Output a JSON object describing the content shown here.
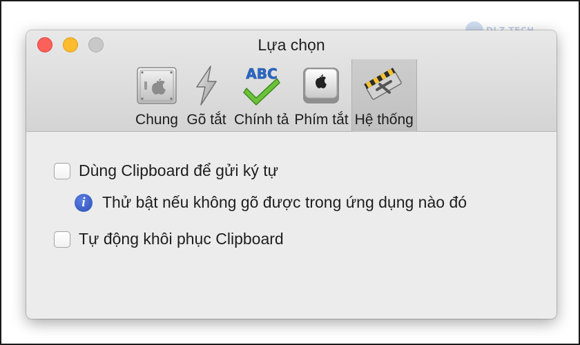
{
  "window": {
    "title": "Lựa chọn"
  },
  "toolbar": {
    "tabs": [
      {
        "label": "Chung",
        "icon": "general-icon",
        "active": false
      },
      {
        "label": "Gõ tắt",
        "icon": "lightning-icon",
        "active": false
      },
      {
        "label": "Chính tả",
        "icon": "abc-check-icon",
        "active": false
      },
      {
        "label": "Phím tắt",
        "icon": "keyboard-key-icon",
        "active": false
      },
      {
        "label": "Hệ thống",
        "icon": "system-icon",
        "active": true
      }
    ]
  },
  "options": {
    "clipboard_send": {
      "label": "Dùng Clipboard để gửi ký tự",
      "checked": false
    },
    "clipboard_hint": "Thử bật nếu không gõ được trong ứng dụng nào đó",
    "clipboard_restore": {
      "label": "Tự động khôi phục Clipboard",
      "checked": false
    }
  },
  "colors": {
    "close": "#fc605b",
    "minimize": "#fdbb2f",
    "zoom": "#c8c8c8",
    "info": "#2b4fb8",
    "check": "#5cb82e"
  }
}
